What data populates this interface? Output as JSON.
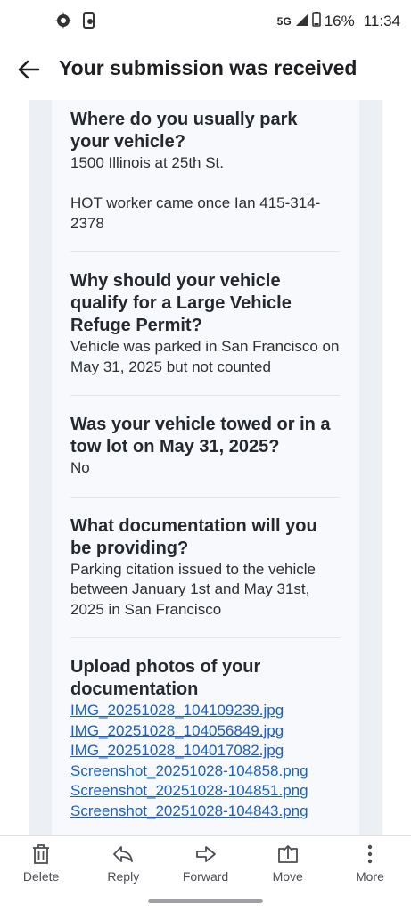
{
  "status": {
    "network": "5G",
    "battery": "16%",
    "time": "11:34"
  },
  "header": {
    "title": "Your submission was received"
  },
  "qa": [
    {
      "question": "Where do you usually park your vehicle?",
      "answer": "1500 Illinois at 25th St.\n\nHOT worker came once Ian 415-314-2378"
    },
    {
      "question": "Why should your vehicle qualify for a Large Vehicle Refuge Permit?",
      "answer": "Vehicle was parked in San Francisco on May 31, 2025 but not counted"
    },
    {
      "question": "Was your vehicle towed or in a tow lot on May 31, 2025?",
      "answer": "No"
    },
    {
      "question": "What documentation will you be providing?",
      "answer": "Parking citation issued to the vehicle between January 1st and May 31st, 2025 in San Francisco"
    },
    {
      "question": "Upload photos of your documentation",
      "files": [
        "IMG_20251028_104109239.jpg",
        "IMG_20251028_104056849.jpg",
        "IMG_20251028_104017082.jpg",
        "Screenshot_20251028-104858.png",
        "Screenshot_20251028-104851.png",
        "Screenshot_20251028-104843.png"
      ]
    }
  ],
  "toolbar": {
    "delete": "Delete",
    "reply": "Reply",
    "forward": "Forward",
    "move": "Move",
    "more": "More"
  },
  "icons": {
    "status_left": [
      "app-notification-icon",
      "phone-notification-icon"
    ],
    "status_right": [
      "signal-icon",
      "battery-icon"
    ],
    "toolbar": [
      "trash-icon",
      "reply-icon",
      "forward-icon",
      "move-icon",
      "more-vertical-icon"
    ]
  },
  "colors": {
    "link": "#1a5fc7",
    "card_background": "#f7f9fc",
    "gutter": "#ecf0f5"
  }
}
